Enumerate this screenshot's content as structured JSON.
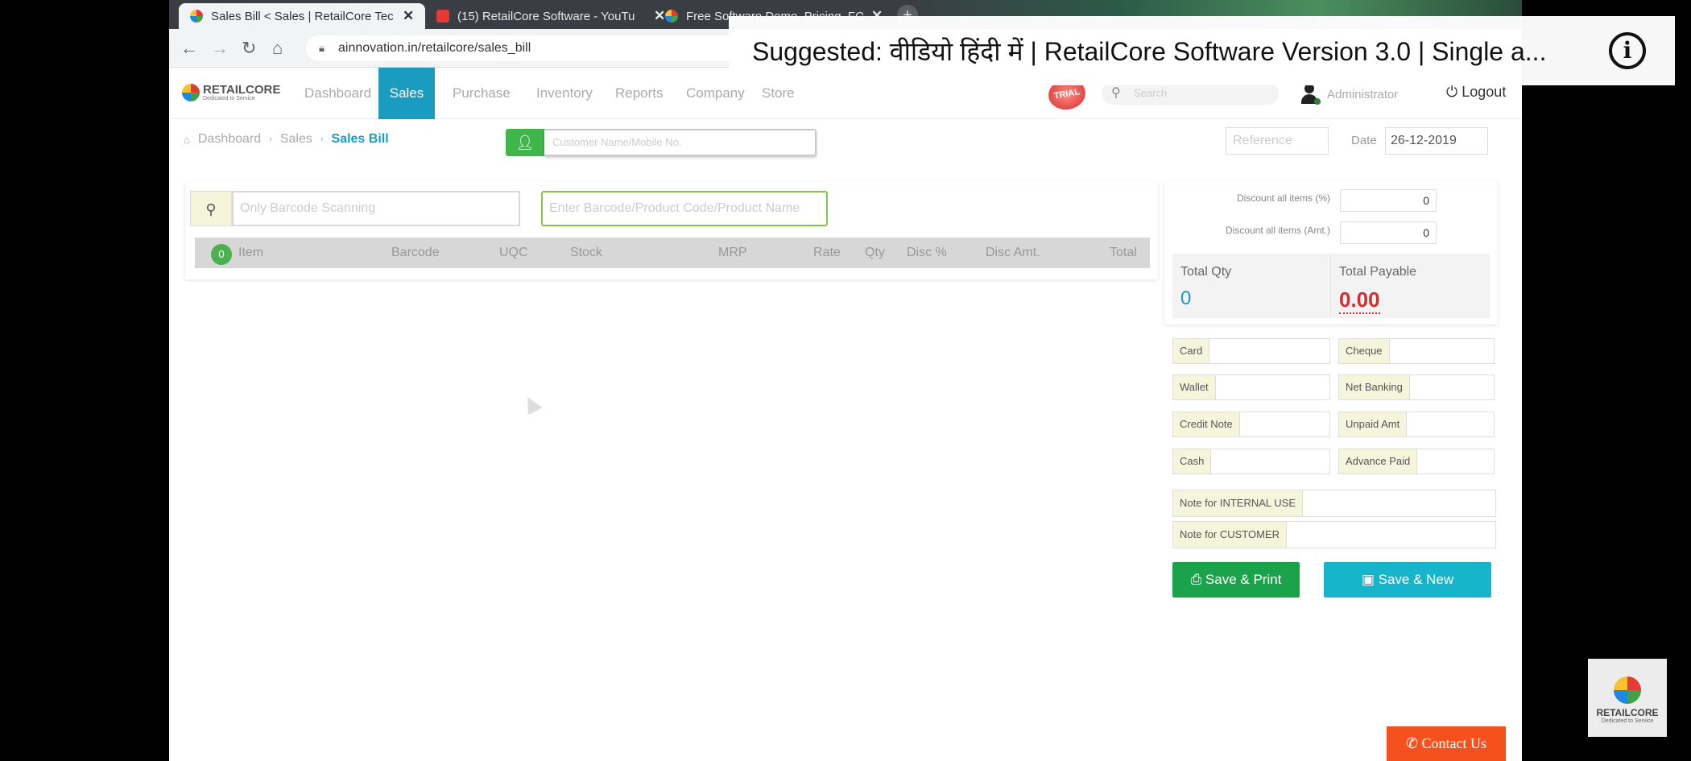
{
  "browser": {
    "tabs": [
      {
        "title": "Sales Bill < Sales | RetailCore Tec",
        "active": true
      },
      {
        "title": "(15) RetailCore Software - YouTu",
        "active": false
      },
      {
        "title": "Free Software Demo, Pricing, FO",
        "active": false
      }
    ],
    "new_tab": "+",
    "url": "ainnovation.in/retailcore/sales_bill"
  },
  "suggestion": {
    "text": "Suggested: वीडियो हिंदी में | RetailCore Software Version 3.0 | Single a...",
    "info": "i"
  },
  "app": {
    "logo_name": "RETAILCORE",
    "logo_tagline": "Dedicated to Service",
    "nav": [
      "Dashboard",
      "Sales",
      "Purchase",
      "Inventory",
      "Reports",
      "Company",
      "Store"
    ],
    "active_nav": "Sales",
    "trial_badge": "TRIAL",
    "search_placeholder": "Search",
    "user": "Administrator",
    "logout": "Logout"
  },
  "breadcrumb": [
    "Dashboard",
    "Sales",
    "Sales Bill"
  ],
  "customer_placeholder": "Customer Name/Mobile No.",
  "reference_placeholder": "Reference",
  "date_label": "Date",
  "date_value": "26-12-2019",
  "scan": {
    "barcode_placeholder": "Only Barcode Scanning",
    "product_placeholder": "Enter Barcode/Product Code/Product Name"
  },
  "items_table": {
    "count": "0",
    "columns": [
      "Item",
      "Barcode",
      "UQC",
      "Stock",
      "MRP",
      "Rate",
      "Qty",
      "Disc %",
      "Disc Amt.",
      "Total"
    ]
  },
  "discount": {
    "pct_label": "Discount all items (%)",
    "pct_value": "0",
    "amt_label": "Discount all items (Amt.)",
    "amt_value": "0"
  },
  "totals": {
    "qty_label": "Total Qty",
    "qty_value": "0",
    "payable_label": "Total Payable",
    "payable_value": "0.00"
  },
  "payments": {
    "card": "Card",
    "cheque": "Cheque",
    "wallet": "Wallet",
    "net_banking": "Net Banking",
    "credit_note": "Credit Note",
    "unpaid_amt": "Unpaid Amt",
    "cash": "Cash",
    "advance_paid": "Advance Paid"
  },
  "notes": {
    "internal": "Note for INTERNAL USE",
    "customer": "Note for CUSTOMER"
  },
  "actions": {
    "save_print": "Save & Print",
    "save_new": "Save & New",
    "contact": "Contact Us"
  },
  "watermark": {
    "name": "RETAILCORE",
    "tagline": "Dedicated to Service"
  },
  "colors": {
    "primary": "#1a9bc0",
    "green": "#1aa34a",
    "cyan": "#17b5cc",
    "payable_red": "#d32f2f",
    "contact_orange": "#f4511e"
  }
}
